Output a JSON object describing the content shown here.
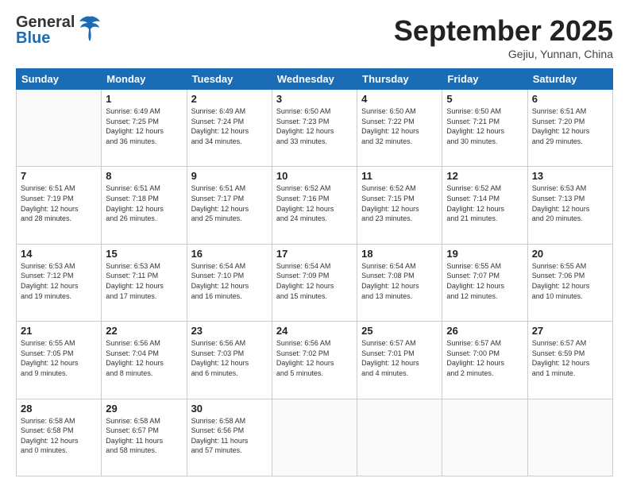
{
  "header": {
    "logo_line1": "General",
    "logo_line2": "Blue",
    "month": "September 2025",
    "location": "Gejiu, Yunnan, China"
  },
  "weekdays": [
    "Sunday",
    "Monday",
    "Tuesday",
    "Wednesday",
    "Thursday",
    "Friday",
    "Saturday"
  ],
  "weeks": [
    [
      {
        "day": "",
        "info": ""
      },
      {
        "day": "1",
        "info": "Sunrise: 6:49 AM\nSunset: 7:25 PM\nDaylight: 12 hours\nand 36 minutes."
      },
      {
        "day": "2",
        "info": "Sunrise: 6:49 AM\nSunset: 7:24 PM\nDaylight: 12 hours\nand 34 minutes."
      },
      {
        "day": "3",
        "info": "Sunrise: 6:50 AM\nSunset: 7:23 PM\nDaylight: 12 hours\nand 33 minutes."
      },
      {
        "day": "4",
        "info": "Sunrise: 6:50 AM\nSunset: 7:22 PM\nDaylight: 12 hours\nand 32 minutes."
      },
      {
        "day": "5",
        "info": "Sunrise: 6:50 AM\nSunset: 7:21 PM\nDaylight: 12 hours\nand 30 minutes."
      },
      {
        "day": "6",
        "info": "Sunrise: 6:51 AM\nSunset: 7:20 PM\nDaylight: 12 hours\nand 29 minutes."
      }
    ],
    [
      {
        "day": "7",
        "info": "Sunrise: 6:51 AM\nSunset: 7:19 PM\nDaylight: 12 hours\nand 28 minutes."
      },
      {
        "day": "8",
        "info": "Sunrise: 6:51 AM\nSunset: 7:18 PM\nDaylight: 12 hours\nand 26 minutes."
      },
      {
        "day": "9",
        "info": "Sunrise: 6:51 AM\nSunset: 7:17 PM\nDaylight: 12 hours\nand 25 minutes."
      },
      {
        "day": "10",
        "info": "Sunrise: 6:52 AM\nSunset: 7:16 PM\nDaylight: 12 hours\nand 24 minutes."
      },
      {
        "day": "11",
        "info": "Sunrise: 6:52 AM\nSunset: 7:15 PM\nDaylight: 12 hours\nand 23 minutes."
      },
      {
        "day": "12",
        "info": "Sunrise: 6:52 AM\nSunset: 7:14 PM\nDaylight: 12 hours\nand 21 minutes."
      },
      {
        "day": "13",
        "info": "Sunrise: 6:53 AM\nSunset: 7:13 PM\nDaylight: 12 hours\nand 20 minutes."
      }
    ],
    [
      {
        "day": "14",
        "info": "Sunrise: 6:53 AM\nSunset: 7:12 PM\nDaylight: 12 hours\nand 19 minutes."
      },
      {
        "day": "15",
        "info": "Sunrise: 6:53 AM\nSunset: 7:11 PM\nDaylight: 12 hours\nand 17 minutes."
      },
      {
        "day": "16",
        "info": "Sunrise: 6:54 AM\nSunset: 7:10 PM\nDaylight: 12 hours\nand 16 minutes."
      },
      {
        "day": "17",
        "info": "Sunrise: 6:54 AM\nSunset: 7:09 PM\nDaylight: 12 hours\nand 15 minutes."
      },
      {
        "day": "18",
        "info": "Sunrise: 6:54 AM\nSunset: 7:08 PM\nDaylight: 12 hours\nand 13 minutes."
      },
      {
        "day": "19",
        "info": "Sunrise: 6:55 AM\nSunset: 7:07 PM\nDaylight: 12 hours\nand 12 minutes."
      },
      {
        "day": "20",
        "info": "Sunrise: 6:55 AM\nSunset: 7:06 PM\nDaylight: 12 hours\nand 10 minutes."
      }
    ],
    [
      {
        "day": "21",
        "info": "Sunrise: 6:55 AM\nSunset: 7:05 PM\nDaylight: 12 hours\nand 9 minutes."
      },
      {
        "day": "22",
        "info": "Sunrise: 6:56 AM\nSunset: 7:04 PM\nDaylight: 12 hours\nand 8 minutes."
      },
      {
        "day": "23",
        "info": "Sunrise: 6:56 AM\nSunset: 7:03 PM\nDaylight: 12 hours\nand 6 minutes."
      },
      {
        "day": "24",
        "info": "Sunrise: 6:56 AM\nSunset: 7:02 PM\nDaylight: 12 hours\nand 5 minutes."
      },
      {
        "day": "25",
        "info": "Sunrise: 6:57 AM\nSunset: 7:01 PM\nDaylight: 12 hours\nand 4 minutes."
      },
      {
        "day": "26",
        "info": "Sunrise: 6:57 AM\nSunset: 7:00 PM\nDaylight: 12 hours\nand 2 minutes."
      },
      {
        "day": "27",
        "info": "Sunrise: 6:57 AM\nSunset: 6:59 PM\nDaylight: 12 hours\nand 1 minute."
      }
    ],
    [
      {
        "day": "28",
        "info": "Sunrise: 6:58 AM\nSunset: 6:58 PM\nDaylight: 12 hours\nand 0 minutes."
      },
      {
        "day": "29",
        "info": "Sunrise: 6:58 AM\nSunset: 6:57 PM\nDaylight: 11 hours\nand 58 minutes."
      },
      {
        "day": "30",
        "info": "Sunrise: 6:58 AM\nSunset: 6:56 PM\nDaylight: 11 hours\nand 57 minutes."
      },
      {
        "day": "",
        "info": ""
      },
      {
        "day": "",
        "info": ""
      },
      {
        "day": "",
        "info": ""
      },
      {
        "day": "",
        "info": ""
      }
    ]
  ]
}
